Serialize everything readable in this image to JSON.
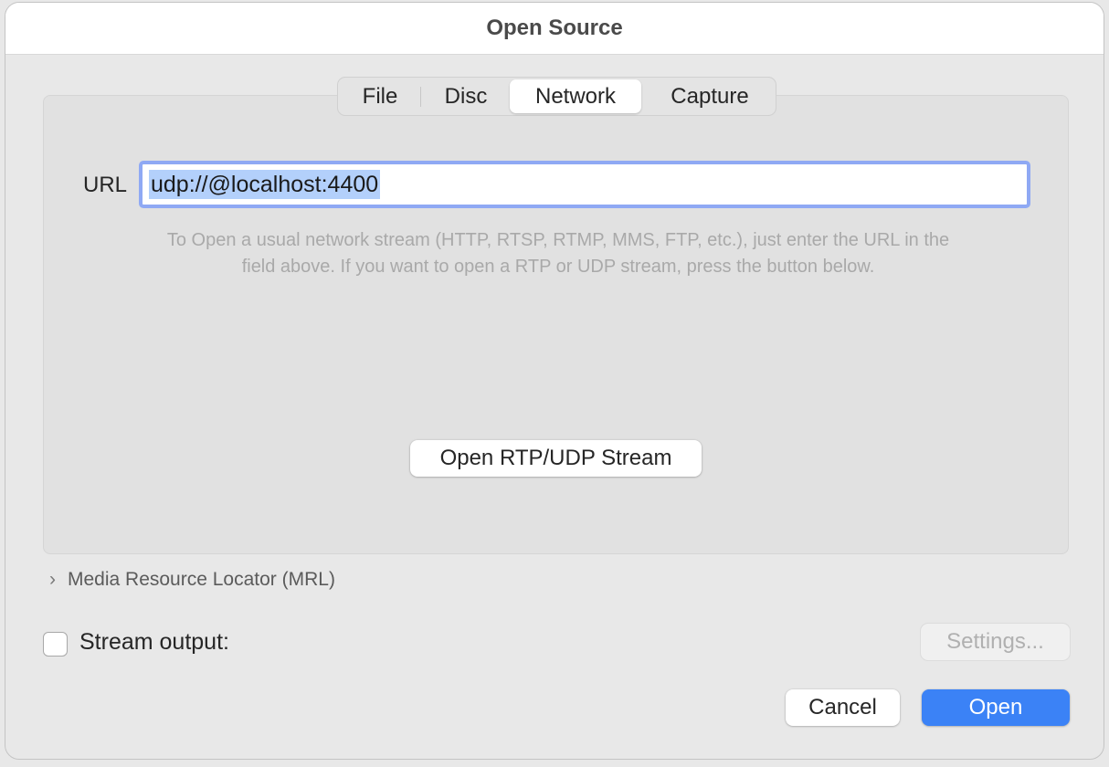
{
  "window": {
    "title": "Open Source"
  },
  "tabs": {
    "file": "File",
    "disc": "Disc",
    "network": "Network",
    "capture": "Capture",
    "selected": "Network"
  },
  "network": {
    "url_label": "URL",
    "url_value": "udp://@localhost:4400",
    "hint_line1": "To Open a usual network stream (HTTP, RTSP, RTMP, MMS, FTP, etc.), just enter the URL in the",
    "hint_line2": "field above. If you want to open a RTP or UDP stream, press the button below.",
    "rtp_button": "Open RTP/UDP Stream"
  },
  "mrl": {
    "chevron": "›",
    "label": "Media Resource Locator (MRL)"
  },
  "stream_output": {
    "label": "Stream output:",
    "checked": false,
    "settings_button": "Settings..."
  },
  "actions": {
    "cancel": "Cancel",
    "open": "Open"
  },
  "colors": {
    "accent": "#3b82f6",
    "focus_ring": "#8fa9f4",
    "selection": "#b3d0fb"
  }
}
